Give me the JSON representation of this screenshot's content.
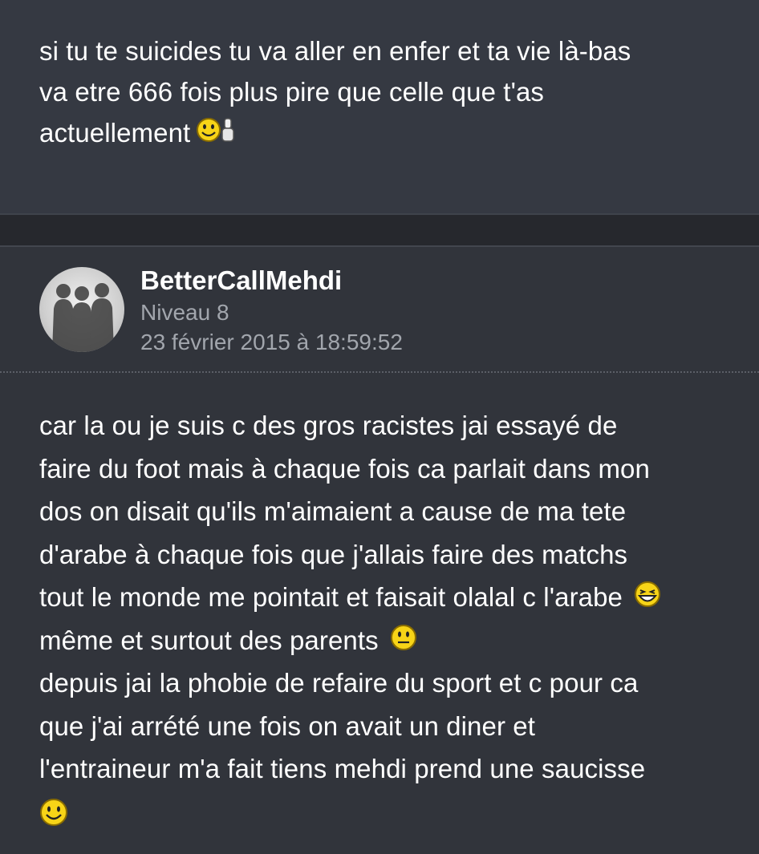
{
  "previous_post": {
    "lines": [
      "si tu te suicides tu va aller en enfer et ta vie là-bas",
      "va etre 666 fois plus pire que celle que t'as",
      "actuellement"
    ]
  },
  "post": {
    "author": "BetterCallMehdi",
    "level": "Niveau 8",
    "date": "23 février 2015 à 18:59:52",
    "lines": [
      "car la ou je suis c des gros racistes jai essayé de",
      "faire du foot mais à chaque fois ca parlait dans mon",
      "dos on disait qu'ils m'aimaient a cause de ma tete",
      "d'arabe à chaque fois que j'allais faire des matchs",
      "tout le monde me pointait et faisait olalal c l'arabe",
      "même et surtout des parents",
      "depuis jai la phobie de refaire du sport et c pour ca",
      "que j'ai arrété une fois on avait un diner et",
      "l'entraineur m'a fait tiens mehdi prend une saucisse"
    ]
  },
  "icons": {
    "prev_smiley": "thumbs-up-smiley-icon",
    "laugh_smiley": "laughing-smiley-icon",
    "neutral_smiley": "neutral-smiley-icon",
    "smile_smiley": "smile-smiley-icon",
    "avatar": "avatar-silhouettes"
  },
  "colors": {
    "background": "#2b2e35",
    "post_prev_bg": "#353942",
    "post_bg": "#31343b",
    "separator": "#26282d",
    "muted_text": "#a2a6ad",
    "smiley_yellow": "#f7d417"
  }
}
